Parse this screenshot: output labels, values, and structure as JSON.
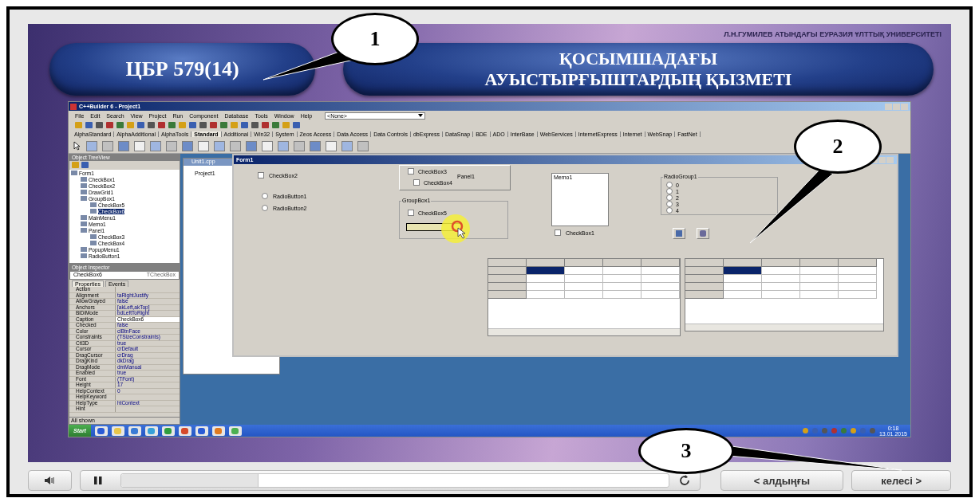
{
  "slide": {
    "university": "Л.Н.ГУМИЛЕВ АТЫНДАҒЫ ЕУРАЗИЯ ҰЛТТЫҚ УНИВЕРСИТЕТІ",
    "code": "ЦБР 579(14)",
    "title_lines": [
      "ҚОСЫМШАДАҒЫ",
      "АУЫСТЫРҒЫШТАРДЫҢ ҚЫЗМЕТІ"
    ]
  },
  "ide": {
    "title": "C++Builder 6 - Project1",
    "menu": [
      "File",
      "Edit",
      "Search",
      "View",
      "Project",
      "Run",
      "Component",
      "Database",
      "Tools",
      "Window",
      "Help"
    ],
    "target_combo": "<None>",
    "palette_tabs": [
      {
        "label": "AlphaStandard",
        "selected": false
      },
      {
        "label": "AlphaAdditional",
        "selected": false
      },
      {
        "label": "AlphaTools",
        "selected": false
      },
      {
        "label": "Standard",
        "selected": true
      },
      {
        "label": "Additional",
        "selected": false
      },
      {
        "label": "Win32",
        "selected": false
      },
      {
        "label": "System",
        "selected": false
      },
      {
        "label": "Zeos Access",
        "selected": false
      },
      {
        "label": "Data Access",
        "selected": false
      },
      {
        "label": "Data Controls",
        "selected": false
      },
      {
        "label": "dbExpress",
        "selected": false
      },
      {
        "label": "DataSnap",
        "selected": false
      },
      {
        "label": "BDE",
        "selected": false
      },
      {
        "label": "ADO",
        "selected": false
      },
      {
        "label": "InterBase",
        "selected": false
      },
      {
        "label": "WebServices",
        "selected": false
      },
      {
        "label": "InternetExpress",
        "selected": false
      },
      {
        "label": "Internet",
        "selected": false
      },
      {
        "label": "WebSnap",
        "selected": false
      },
      {
        "label": "FastNet",
        "selected": false
      }
    ],
    "tree_view": {
      "title": "Object TreeView",
      "items": [
        {
          "label": "Form1",
          "selected": false,
          "children": [
            {
              "label": "CheckBox1",
              "selected": false
            },
            {
              "label": "CheckBox2",
              "selected": false
            },
            {
              "label": "DrawGrid1",
              "selected": false
            },
            {
              "label": "GroupBox1",
              "selected": false,
              "children": [
                {
                  "label": "CheckBox5",
                  "selected": false
                },
                {
                  "label": "CheckBox6",
                  "selected": true
                }
              ]
            },
            {
              "label": "MainMenu1",
              "selected": false
            },
            {
              "label": "Memo1",
              "selected": false
            },
            {
              "label": "Panel1",
              "selected": false,
              "children": [
                {
                  "label": "CheckBox3",
                  "selected": false
                },
                {
                  "label": "CheckBox4",
                  "selected": false
                }
              ]
            },
            {
              "label": "PopupMenu1",
              "selected": false
            },
            {
              "label": "RadioButton1",
              "selected": false
            }
          ]
        }
      ]
    },
    "inspector": {
      "title": "Object Inspector",
      "object": "CheckBox6",
      "object_type": "TCheckBox",
      "tabs": [
        {
          "label": "Properties",
          "selected": true
        },
        {
          "label": "Events",
          "selected": false
        }
      ],
      "properties": [
        {
          "name": "Action",
          "selected": false
        },
        {
          "name": "Alignment",
          "value": "taRightJustify",
          "selected": false
        },
        {
          "name": "AllowGrayed",
          "value": "false",
          "selected": false
        },
        {
          "name": "Anchors",
          "value": "[akLeft,akTop]",
          "selected": false
        },
        {
          "name": "BiDiMode",
          "value": "bdLeftToRight",
          "selected": false
        },
        {
          "name": "Caption",
          "value": "CheckBox6",
          "selected": true
        },
        {
          "name": "Checked",
          "value": "false",
          "selected": false
        },
        {
          "name": "Color",
          "value": "clBtnFace",
          "selected": false
        },
        {
          "name": "Constraints",
          "value": "(TSizeConstraints)",
          "selected": false
        },
        {
          "name": "Ctl3D",
          "value": "true",
          "selected": false
        },
        {
          "name": "Cursor",
          "value": "crDefault",
          "selected": false
        },
        {
          "name": "DragCursor",
          "value": "crDrag",
          "selected": false
        },
        {
          "name": "DragKind",
          "value": "dkDrag",
          "selected": false
        },
        {
          "name": "DragMode",
          "value": "dmManual",
          "selected": false
        },
        {
          "name": "Enabled",
          "value": "true",
          "selected": false
        },
        {
          "name": "Font",
          "value": "(TFont)",
          "selected": false
        },
        {
          "name": "Height",
          "value": "17",
          "selected": false
        },
        {
          "name": "HelpContext",
          "value": "0",
          "selected": false
        },
        {
          "name": "HelpKeyword",
          "selected": false
        },
        {
          "name": "HelpType",
          "value": "htContext",
          "selected": false
        },
        {
          "name": "Hint",
          "selected": false
        }
      ],
      "status": "All shown"
    },
    "editor": {
      "title": "Unit1.cpp",
      "tree_item": "Project1"
    },
    "form": {
      "title": "Form1",
      "controls": [
        {
          "kind": "checkbox",
          "label": "CheckBox2",
          "checked": false
        },
        {
          "kind": "radio",
          "label": "RadioButton1",
          "checked": false
        },
        {
          "kind": "radio",
          "label": "RadioButton2",
          "checked": false
        },
        {
          "kind": "panel",
          "label": "Panel1",
          "children": [
            {
              "label": "CheckBox3",
              "checked": false
            },
            {
              "label": "CheckBox4",
              "checked": false
            }
          ]
        },
        {
          "kind": "groupbox",
          "label": "GroupBox1",
          "children": [
            {
              "label": "CheckBox5",
              "checked": false
            }
          ]
        },
        {
          "kind": "memo",
          "label": "Memo1"
        },
        {
          "kind": "checkbox",
          "label": "CheckBox1",
          "checked": false
        },
        {
          "kind": "radiogroup",
          "label": "RadioGroup1",
          "items": [
            {
              "label": "0",
              "selected": false
            },
            {
              "label": "1",
              "selected": false
            },
            {
              "label": "2",
              "selected": false
            },
            {
              "label": "3",
              "selected": false
            },
            {
              "label": "4",
              "selected": false
            }
          ]
        },
        {
          "kind": "speedbutton"
        },
        {
          "kind": "speedbutton"
        },
        {
          "kind": "grid",
          "rows": [
            {
              "cells": [
                {
                  "selected": false
                },
                {
                  "selected": false
                },
                {
                  "selected": false
                },
                {
                  "selected": false
                },
                {
                  "selected": false
                }
              ]
            },
            {
              "cells": [
                {
                  "selected": false
                },
                {
                  "selected": true
                },
                {
                  "selected": false
                },
                {
                  "selected": false
                },
                {
                  "selected": false
                }
              ]
            },
            {
              "cells": [
                {
                  "selected": false
                },
                {
                  "selected": false
                },
                {
                  "selected": false
                },
                {
                  "selected": false
                },
                {
                  "selected": false
                }
              ]
            },
            {
              "cells": [
                {
                  "selected": false
                },
                {
                  "selected": false
                },
                {
                  "selected": false
                },
                {
                  "selected": false
                },
                {
                  "selected": false
                }
              ]
            },
            {
              "cells": [
                {
                  "selected": false
                },
                {
                  "selected": false
                },
                {
                  "selected": false
                },
                {
                  "selected": false
                },
                {
                  "selected": false
                }
              ]
            }
          ]
        },
        {
          "kind": "grid",
          "rows": [
            {
              "cells": [
                {
                  "selected": false
                },
                {
                  "selected": false
                },
                {
                  "selected": false
                },
                {
                  "selected": false
                },
                {
                  "selected": false
                }
              ]
            },
            {
              "cells": [
                {
                  "selected": false
                },
                {
                  "selected": true
                },
                {
                  "selected": false
                },
                {
                  "selected": false
                },
                {
                  "selected": false
                }
              ]
            },
            {
              "cells": [
                {
                  "selected": false
                },
                {
                  "selected": false
                },
                {
                  "selected": false
                },
                {
                  "selected": false
                },
                {
                  "selected": false
                }
              ]
            },
            {
              "cells": [
                {
                  "selected": false
                },
                {
                  "selected": false
                },
                {
                  "selected": false
                },
                {
                  "selected": false
                },
                {
                  "selected": false
                }
              ]
            },
            {
              "cells": [
                {
                  "selected": false
                },
                {
                  "selected": false
                },
                {
                  "selected": false
                },
                {
                  "selected": false
                },
                {
                  "selected": false
                }
              ]
            }
          ]
        }
      ]
    },
    "taskbar": {
      "start": "Start",
      "time": "0:18",
      "date": "13.01.2015"
    }
  },
  "callouts": [
    {
      "label": "1"
    },
    {
      "label": "2"
    },
    {
      "label": "3"
    }
  ],
  "player": {
    "playing": true,
    "progress": {
      "level": 0.25
    },
    "buttons": [
      {
        "label": "< алдыңғы"
      },
      {
        "label": "келесі >"
      }
    ]
  }
}
